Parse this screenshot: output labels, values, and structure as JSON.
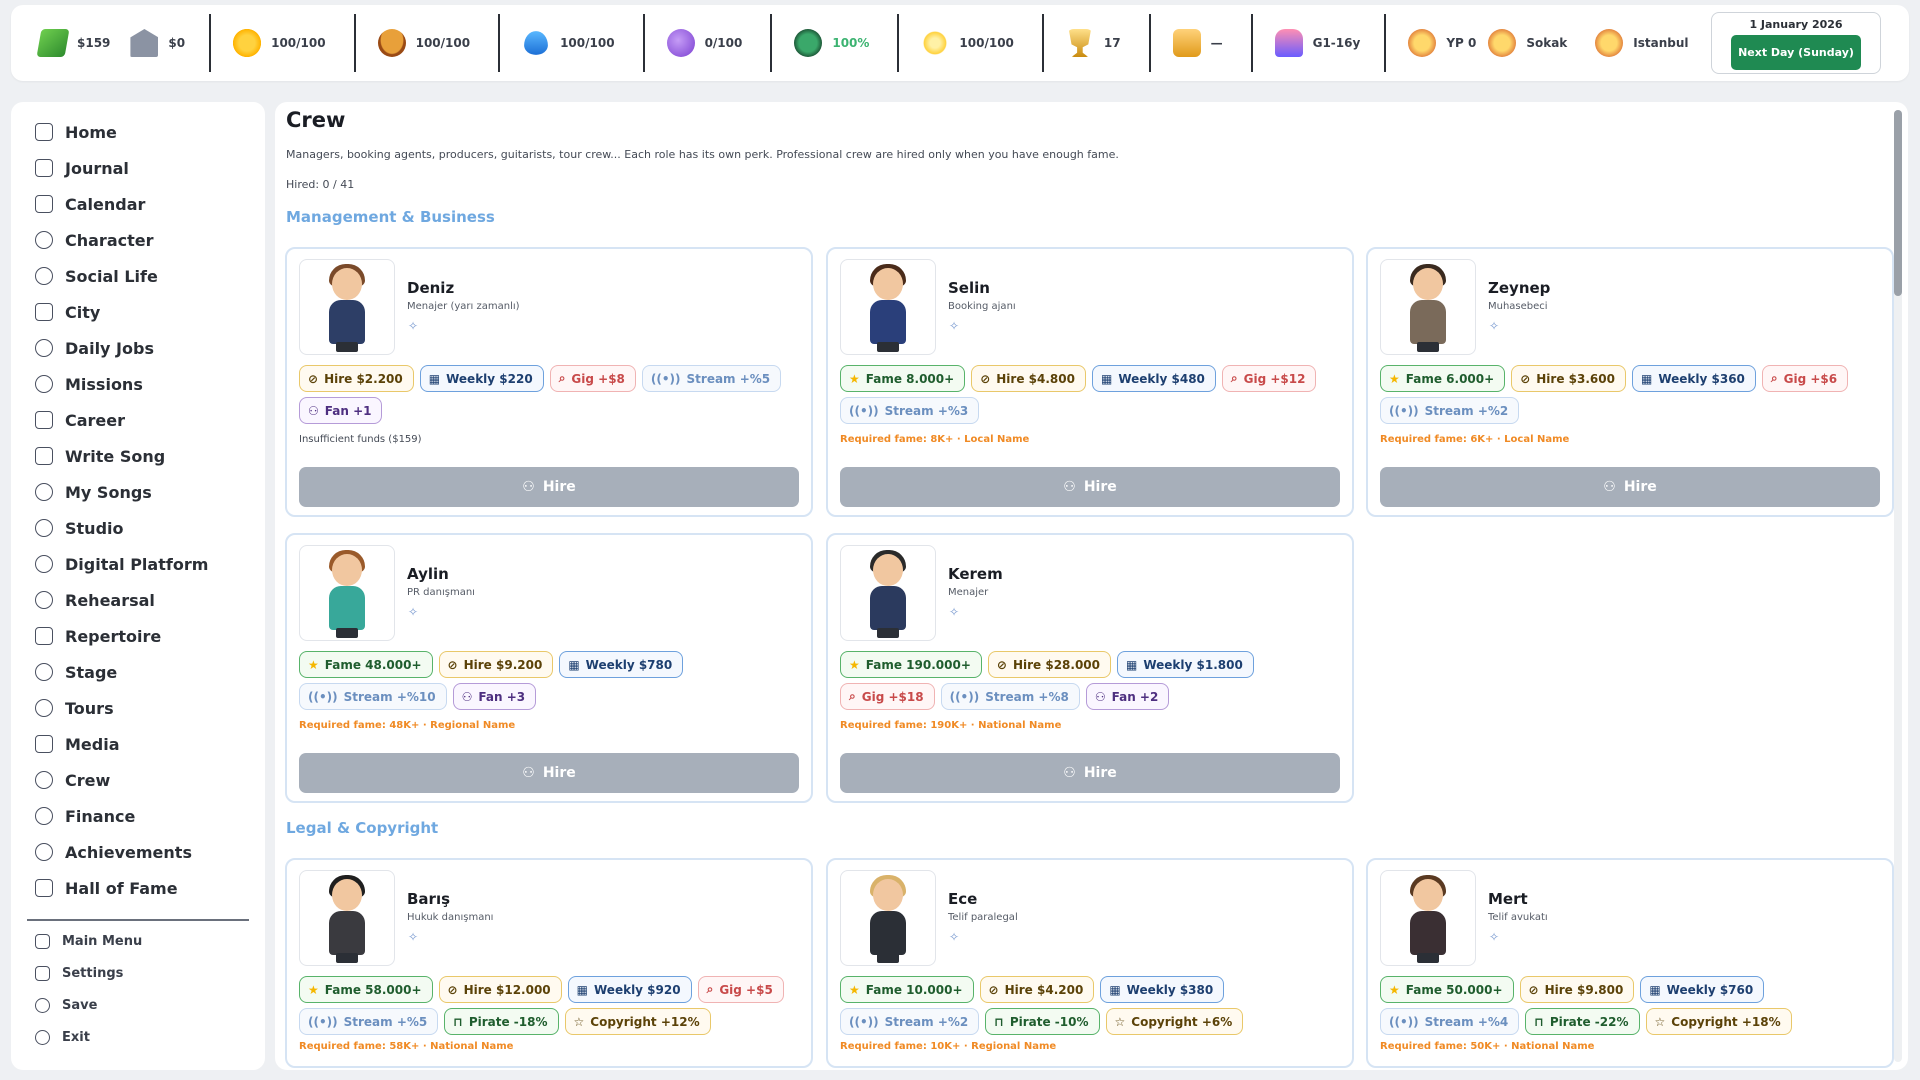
{
  "topbar": {
    "stats": [
      {
        "icon": "cash-icon",
        "value": "$159"
      },
      {
        "icon": "bank-icon",
        "value": "$0"
      },
      {
        "icon": "sun-icon",
        "value": "100/100"
      },
      {
        "icon": "burger-icon",
        "value": "100/100"
      },
      {
        "icon": "water-drop-icon",
        "value": "100/100"
      },
      {
        "icon": "orb-icon",
        "value": "0/100"
      },
      {
        "icon": "heart-icon",
        "value": "100%",
        "color": "#3cb371"
      },
      {
        "icon": "sparkle-icon",
        "value": "100/100"
      },
      {
        "icon": "trophy-icon",
        "value": "17"
      },
      {
        "icon": "box-icon",
        "value": "—"
      },
      {
        "icon": "stage-icon",
        "value": "G1-16y"
      },
      {
        "icon": "crowd-icon",
        "value": "YP 0"
      },
      {
        "icon": "crowd-icon",
        "value": "Sokak"
      },
      {
        "icon": "crowd-icon",
        "value": "Istanbul"
      }
    ],
    "date": "1 January 2026",
    "next_day_label": "Next Day (Sunday)"
  },
  "sidebar": {
    "items": [
      {
        "label": "Home",
        "icon": "home-icon"
      },
      {
        "label": "Journal",
        "icon": "journal-icon"
      },
      {
        "label": "Calendar",
        "icon": "calendar-icon"
      },
      {
        "label": "Character",
        "icon": "character-icon"
      },
      {
        "label": "Social Life",
        "icon": "users-icon"
      },
      {
        "label": "City",
        "icon": "pulse-icon"
      },
      {
        "label": "Daily Jobs",
        "icon": "link-icon"
      },
      {
        "label": "Missions",
        "icon": "flame-icon"
      },
      {
        "label": "Career",
        "icon": "trend-icon"
      },
      {
        "label": "Write Song",
        "icon": "music-note-icon"
      },
      {
        "label": "My Songs",
        "icon": "disc-icon"
      },
      {
        "label": "Studio",
        "icon": "broadcast-icon"
      },
      {
        "label": "Digital Platform",
        "icon": "broadcast-icon"
      },
      {
        "label": "Rehearsal",
        "icon": "mic-icon"
      },
      {
        "label": "Repertoire",
        "icon": "music-note-icon"
      },
      {
        "label": "Stage",
        "icon": "target-icon"
      },
      {
        "label": "Tours",
        "icon": "flame-icon"
      },
      {
        "label": "Media",
        "icon": "camera-icon"
      },
      {
        "label": "Crew",
        "icon": "users-icon"
      },
      {
        "label": "Finance",
        "icon": "link-icon"
      },
      {
        "label": "Achievements",
        "icon": "medal-icon"
      },
      {
        "label": "Hall of Fame",
        "icon": "star-icon"
      }
    ],
    "bottom": [
      {
        "label": "Main Menu",
        "icon": "home-icon"
      },
      {
        "label": "Settings",
        "icon": "pulse-icon"
      },
      {
        "label": "Save",
        "icon": "target-icon"
      },
      {
        "label": "Exit",
        "icon": "flame-icon"
      }
    ]
  },
  "main": {
    "title": "Crew",
    "description": "Managers, booking agents, producers, guitarists, tour crew... Each role has its own perk. Professional crew are hired only when you have enough fame.",
    "hired": "Hired: 0 / 41",
    "sections": [
      {
        "title": "Management & Business"
      },
      {
        "title": "Legal & Copyright"
      }
    ],
    "hire_label": "Hire",
    "cards": [
      {
        "name": "Deniz",
        "role": "Menajer (yarı zamanlı)",
        "tags": [
          {
            "type": "hire",
            "icon": "link-icon",
            "text": "Hire $2.200"
          },
          {
            "type": "weekly",
            "icon": "calendar-icon",
            "text": "Weekly $220"
          },
          {
            "type": "gig",
            "icon": "mic-icon",
            "text": "Gig +$8"
          },
          {
            "type": "stream",
            "icon": "broadcast-icon",
            "text": "Stream +%5"
          },
          {
            "type": "fan",
            "icon": "users-icon",
            "text": "Fan +1"
          }
        ],
        "note": "Insufficient funds ($159)",
        "note_style": "gray"
      },
      {
        "name": "Selin",
        "role": "Booking ajanı",
        "tags": [
          {
            "type": "fame",
            "icon": "star-icon",
            "text": "Fame 8.000+"
          },
          {
            "type": "hire",
            "icon": "link-icon",
            "text": "Hire $4.800"
          },
          {
            "type": "weekly",
            "icon": "calendar-icon",
            "text": "Weekly $480"
          },
          {
            "type": "gig",
            "icon": "mic-icon",
            "text": "Gig +$12"
          },
          {
            "type": "stream",
            "icon": "broadcast-icon",
            "text": "Stream +%3"
          }
        ],
        "note": "Required fame: 8K+ · Local Name",
        "note_style": "orange"
      },
      {
        "name": "Zeynep",
        "role": "Muhasebeci",
        "tags": [
          {
            "type": "fame",
            "icon": "star-icon",
            "text": "Fame 6.000+"
          },
          {
            "type": "hire",
            "icon": "link-icon",
            "text": "Hire $3.600"
          },
          {
            "type": "weekly",
            "icon": "calendar-icon",
            "text": "Weekly $360"
          },
          {
            "type": "gig",
            "icon": "mic-icon",
            "text": "Gig +$6"
          },
          {
            "type": "stream",
            "icon": "broadcast-icon",
            "text": "Stream +%2"
          }
        ],
        "note": "Required fame: 6K+ · Local Name",
        "note_style": "orange"
      },
      {
        "name": "Aylin",
        "role": "PR danışmanı",
        "tags": [
          {
            "type": "fame",
            "icon": "star-icon",
            "text": "Fame 48.000+"
          },
          {
            "type": "hire",
            "icon": "link-icon",
            "text": "Hire $9.200"
          },
          {
            "type": "weekly",
            "icon": "calendar-icon",
            "text": "Weekly $780"
          },
          {
            "type": "stream",
            "icon": "broadcast-icon",
            "text": "Stream +%10"
          },
          {
            "type": "fan",
            "icon": "users-icon",
            "text": "Fan +3"
          }
        ],
        "note": "Required fame: 48K+ · Regional Name",
        "note_style": "orange"
      },
      {
        "name": "Kerem",
        "role": "Menajer",
        "tags": [
          {
            "type": "fame",
            "icon": "star-icon",
            "text": "Fame 190.000+"
          },
          {
            "type": "hire",
            "icon": "link-icon",
            "text": "Hire $28.000"
          },
          {
            "type": "weekly",
            "icon": "calendar-icon",
            "text": "Weekly $1.800"
          },
          {
            "type": "gig",
            "icon": "mic-icon",
            "text": "Gig +$18"
          },
          {
            "type": "stream",
            "icon": "broadcast-icon",
            "text": "Stream +%8"
          },
          {
            "type": "fan",
            "icon": "users-icon",
            "text": "Fan +2"
          }
        ],
        "note": "Required fame: 190K+ · National Name",
        "note_style": "orange"
      },
      {
        "name": "Barış",
        "role": "Hukuk danışmanı",
        "tags": [
          {
            "type": "fame",
            "icon": "star-icon",
            "text": "Fame 58.000+"
          },
          {
            "type": "hire",
            "icon": "link-icon",
            "text": "Hire $12.000"
          },
          {
            "type": "weekly",
            "icon": "calendar-icon",
            "text": "Weekly $920"
          },
          {
            "type": "gig",
            "icon": "mic-icon",
            "text": "Gig +$5"
          },
          {
            "type": "stream",
            "icon": "broadcast-icon",
            "text": "Stream +%5"
          },
          {
            "type": "pirate",
            "icon": "lock-icon",
            "text": "Pirate -18%"
          },
          {
            "type": "copyright",
            "icon": "star-outline-icon",
            "text": "Copyright +12%"
          }
        ],
        "note": "Required fame: 58K+ · National Name",
        "note_style": "orange"
      },
      {
        "name": "Ece",
        "role": "Telif paralegal",
        "tags": [
          {
            "type": "fame",
            "icon": "star-icon",
            "text": "Fame 10.000+"
          },
          {
            "type": "hire",
            "icon": "link-icon",
            "text": "Hire $4.200"
          },
          {
            "type": "weekly",
            "icon": "calendar-icon",
            "text": "Weekly $380"
          },
          {
            "type": "stream",
            "icon": "broadcast-icon",
            "text": "Stream +%2"
          },
          {
            "type": "pirate",
            "icon": "lock-icon",
            "text": "Pirate -10%"
          },
          {
            "type": "copyright",
            "icon": "star-outline-icon",
            "text": "Copyright +6%"
          }
        ],
        "note": "Required fame: 10K+ · Regional Name",
        "note_style": "orange"
      },
      {
        "name": "Mert",
        "role": "Telif avukatı",
        "tags": [
          {
            "type": "fame",
            "icon": "star-icon",
            "text": "Fame 50.000+"
          },
          {
            "type": "hire",
            "icon": "link-icon",
            "text": "Hire $9.800"
          },
          {
            "type": "weekly",
            "icon": "calendar-icon",
            "text": "Weekly $760"
          },
          {
            "type": "stream",
            "icon": "broadcast-icon",
            "text": "Stream +%4"
          },
          {
            "type": "pirate",
            "icon": "lock-icon",
            "text": "Pirate -22%"
          },
          {
            "type": "copyright",
            "icon": "star-outline-icon",
            "text": "Copyright +18%"
          }
        ],
        "note": "Required fame: 50K+ · National Name",
        "note_style": "orange"
      }
    ]
  }
}
